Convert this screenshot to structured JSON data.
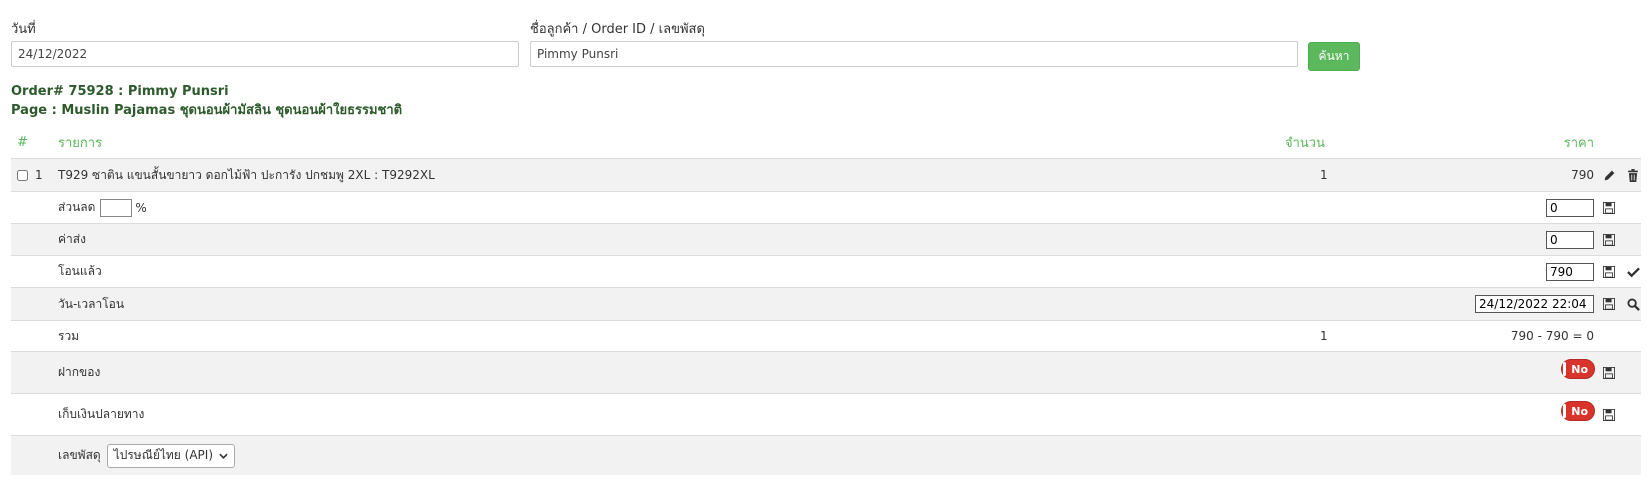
{
  "search": {
    "date_label": "วันที่",
    "date_value": "24/12/2022",
    "customer_label": "ชื่อลูกค้า / Order ID / เลขพัสดุ",
    "customer_value": "Pimmy Punsri",
    "search_button": "ค้นหา"
  },
  "order": {
    "title": "Order# 75928 : Pimmy Punsri",
    "page": "Page : Muslin Pajamas ชุดนอนผ้ามัสลิน ชุดนอนผ้าใยธรรมชาติ"
  },
  "table": {
    "headers": {
      "num": "#",
      "item": "รายการ",
      "qty": "จำนวน",
      "price": "ราคา"
    },
    "item": {
      "index": "1",
      "name": "T929 ซาติน แขนสั้นขายาว ดอกไม้ฟ้า ปะการัง ปกชมพู 2XL : T9292XL",
      "qty": "1",
      "price": "790"
    },
    "discount": {
      "label": "ส่วนลด",
      "percent_value": "",
      "percent_sign": "%",
      "value": "0"
    },
    "shipping": {
      "label": "ค่าส่ง",
      "value": "0"
    },
    "transferred": {
      "label": "โอนแล้ว",
      "value": "790"
    },
    "transfer_time": {
      "label": "วัน-เวลาโอน",
      "value": "24/12/2022 22:04"
    },
    "total": {
      "label": "รวม",
      "qty": "1",
      "calc": "790 - 790 = 0"
    },
    "deposit": {
      "label": "ฝากของ",
      "toggle": "No"
    },
    "cod": {
      "label": "เก็บเงินปลายทาง",
      "toggle": "No"
    },
    "tracking": {
      "label": "เลขพัสดุ",
      "carrier": "ไปรษณีย์ไทย (API)"
    }
  }
}
